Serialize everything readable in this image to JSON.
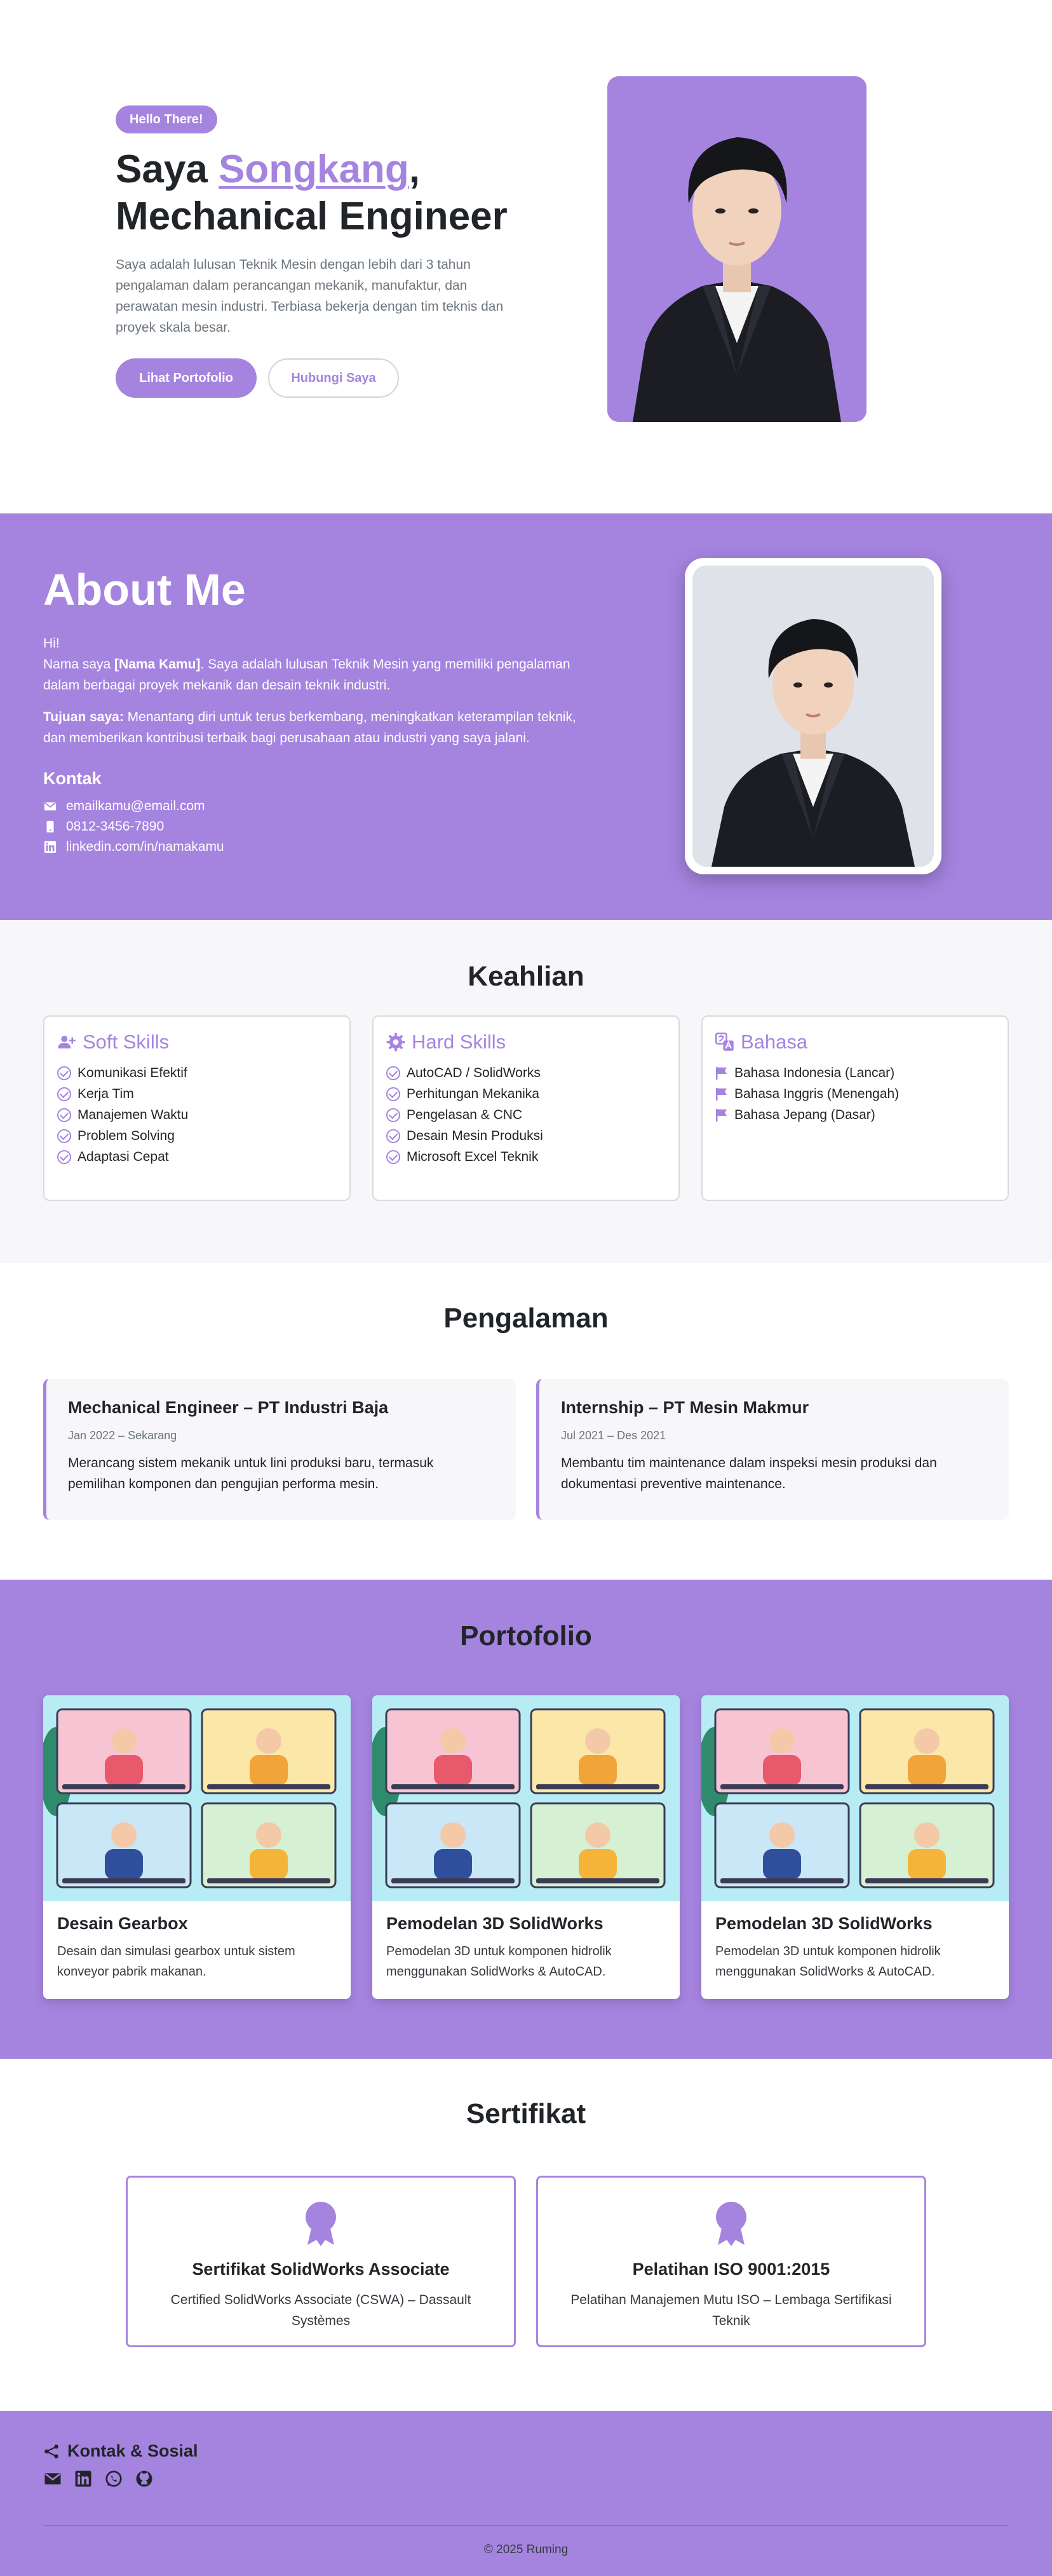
{
  "hero": {
    "badge": "Hello There!",
    "title_prefix": "Saya ",
    "title_name": "Songkang",
    "title_suffix": ",",
    "title_line2": "Mechanical Engineer",
    "description": "Saya adalah lulusan Teknik Mesin dengan lebih dari 3 tahun pengalaman dalam perancangan mekanik, manufaktur, dan perawatan mesin industri. Terbiasa bekerja dengan tim teknis dan proyek skala besar.",
    "btn_primary": "Lihat Portofolio",
    "btn_secondary": "Hubungi Saya"
  },
  "about": {
    "title": "About Me",
    "greeting": "Hi!",
    "intro_before": "Nama saya ",
    "intro_name": "[Nama Kamu]",
    "intro_after": ". Saya adalah lulusan Teknik Mesin yang memiliki pengalaman dalam berbagai proyek mekanik dan desain teknik industri.",
    "goal_label": "Tujuan saya:",
    "goal_text": " Menantang diri untuk terus berkembang, meningkatkan keterampilan teknik, dan memberikan kontribusi terbaik bagi perusahaan atau industri yang saya jalani.",
    "contact_title": "Kontak",
    "email": "emailkamu@email.com",
    "phone": "0812-3456-7890",
    "linkedin": "linkedin.com/in/namakamu"
  },
  "skills": {
    "title": "Keahlian",
    "soft": {
      "title": "Soft Skills",
      "items": [
        "Komunikasi Efektif",
        "Kerja Tim",
        "Manajemen Waktu",
        "Problem Solving",
        "Adaptasi Cepat"
      ]
    },
    "hard": {
      "title": "Hard Skills",
      "items": [
        "AutoCAD / SolidWorks",
        "Perhitungan Mekanika",
        "Pengelasan & CNC",
        "Desain Mesin Produksi",
        "Microsoft Excel Teknik"
      ]
    },
    "lang": {
      "title": "Bahasa",
      "items": [
        "Bahasa Indonesia (Lancar)",
        "Bahasa Inggris (Menengah)",
        "Bahasa Jepang (Dasar)"
      ]
    }
  },
  "experience": {
    "title": "Pengalaman",
    "items": [
      {
        "role": "Mechanical Engineer – PT Industri Baja",
        "date": "Jan 2022 – Sekarang",
        "desc": "Merancang sistem mekanik untuk lini produksi baru, termasuk pemilihan komponen dan pengujian performa mesin."
      },
      {
        "role": "Internship – PT Mesin Makmur",
        "date": "Jul 2021 – Des 2021",
        "desc": "Membantu tim maintenance dalam inspeksi mesin produksi dan dokumentasi preventive maintenance."
      }
    ]
  },
  "portfolio": {
    "title": "Portofolio",
    "items": [
      {
        "title": "Desain Gearbox",
        "desc": "Desain dan simulasi gearbox untuk sistem konveyor pabrik makanan."
      },
      {
        "title": "Pemodelan 3D SolidWorks",
        "desc": "Pemodelan 3D untuk komponen hidrolik menggunakan SolidWorks & AutoCAD."
      },
      {
        "title": "Pemodelan 3D SolidWorks",
        "desc": "Pemodelan 3D untuk komponen hidrolik menggunakan SolidWorks & AutoCAD."
      }
    ]
  },
  "certificates": {
    "title": "Sertifikat",
    "items": [
      {
        "title": "Sertifikat SolidWorks Associate",
        "desc": "Certified SolidWorks Associate (CSWA) – Dassault Systèmes"
      },
      {
        "title": "Pelatihan ISO 9001:2015",
        "desc": "Pelatihan Manajemen Mutu ISO – Lembaga Sertifikasi Teknik"
      }
    ]
  },
  "footer": {
    "title": "Kontak & Sosial",
    "icons": [
      "envelope-icon",
      "linkedin-icon",
      "whatsapp-icon",
      "github-icon"
    ],
    "copyright": "© 2025 Ruming"
  },
  "colors": {
    "accent": "#a584e0",
    "text": "#212529",
    "muted": "#6c757d",
    "light_bg": "#f7f7f9"
  }
}
